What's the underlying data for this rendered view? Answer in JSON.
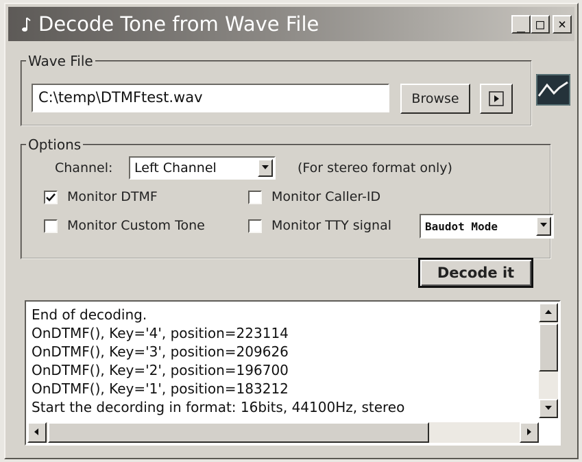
{
  "window": {
    "title": "Decode Tone from Wave File",
    "minimize_label": "_",
    "maximize_label": "□",
    "close_label": "×"
  },
  "wave_file": {
    "legend": "Wave File",
    "path_value": "C:\\temp\\DTMFtest.wav",
    "browse_label": "Browse"
  },
  "options": {
    "legend": "Options",
    "channel_label": "Channel:",
    "channel_value": "Left Channel",
    "channel_note": "(For stereo format only)",
    "monitor_dtmf": {
      "label": "Monitor DTMF",
      "checked": true
    },
    "monitor_caller_id": {
      "label": "Monitor Caller-ID",
      "checked": false
    },
    "monitor_custom_tone": {
      "label": "Monitor Custom Tone",
      "checked": false
    },
    "monitor_tty": {
      "label": "Monitor TTY signal",
      "checked": false
    },
    "tty_mode_value": "Baudot Mode"
  },
  "decode_button_label": "Decode it",
  "log": {
    "lines": [
      "End of decoding.",
      "OnDTMF(), Key='4', position=223114",
      "OnDTMF(), Key='3', position=209626",
      "OnDTMF(), Key='2', position=196700",
      "OnDTMF(), Key='1', position=183212",
      "Start the decording in format: 16bits, 44100Hz, stereo"
    ]
  },
  "icons": {
    "app": "tone-app-icon",
    "play": "play-icon",
    "waveform": "waveform-icon",
    "check": "check-icon"
  },
  "colors": {
    "window_bg": "#d6d3cc",
    "title_gradient_start": "#5d5a57",
    "title_gradient_end": "#c9c6c0",
    "waveform_bg": "#24323a"
  }
}
